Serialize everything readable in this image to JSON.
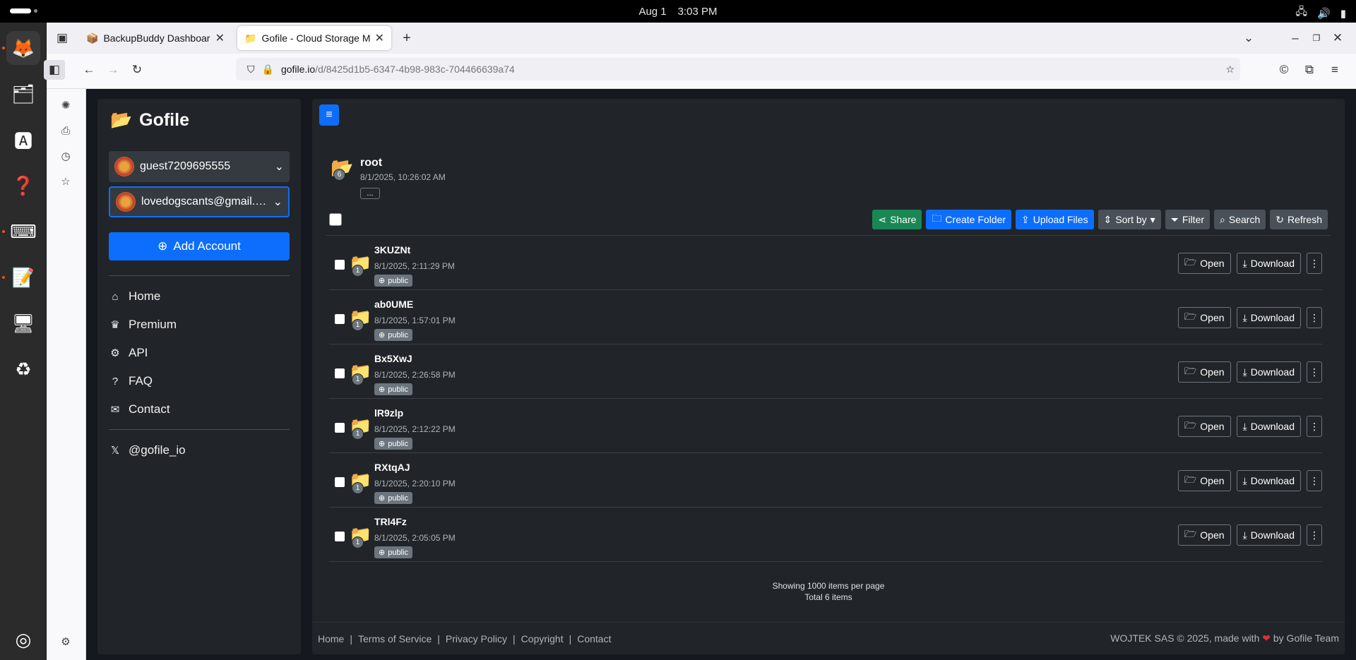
{
  "system": {
    "date": "Aug 1",
    "time": "3:03 PM"
  },
  "browser": {
    "tabs": [
      {
        "icon": "📦",
        "label": "BackupBuddy Dashboard"
      },
      {
        "icon": "📁",
        "label": "Gofile - Cloud Storage Ma"
      }
    ],
    "url_host": "gofile.io",
    "url_path": "/d/8425d1b5-6347-4b98-983c-704466639a74"
  },
  "sidebar": {
    "brand": "Gofile",
    "accounts": [
      "guest7209695555",
      "lovedogscants@gmail.c..."
    ],
    "add_account": "Add Account",
    "menu": [
      "Home",
      "Premium",
      "API",
      "FAQ",
      "Contact"
    ],
    "social": "@gofile_io"
  },
  "folder": {
    "name": "root",
    "date": "8/1/2025, 10:26:02 AM",
    "count": "6",
    "more": "..."
  },
  "toolbar": {
    "share": "Share",
    "create_folder": "Create Folder",
    "upload": "Upload Files",
    "sort": "Sort by",
    "filter": "Filter",
    "search": "Search",
    "refresh": "Refresh"
  },
  "rows": [
    {
      "name": "3KUZNt",
      "date": "8/1/2025, 2:11:29 PM",
      "count": "1",
      "badge": "public"
    },
    {
      "name": "ab0UME",
      "date": "8/1/2025, 1:57:01 PM",
      "count": "1",
      "badge": "public"
    },
    {
      "name": "Bx5XwJ",
      "date": "8/1/2025, 2:26:58 PM",
      "count": "1",
      "badge": "public"
    },
    {
      "name": "lR9zlp",
      "date": "8/1/2025, 2:12:22 PM",
      "count": "1",
      "badge": "public"
    },
    {
      "name": "RXtqAJ",
      "date": "8/1/2025, 2:20:10 PM",
      "count": "1",
      "badge": "public"
    },
    {
      "name": "TRl4Fz",
      "date": "8/1/2025, 2:05:05 PM",
      "count": "1",
      "badge": "public"
    }
  ],
  "row_actions": {
    "open": "Open",
    "download": "Download"
  },
  "pagination": {
    "per_page": "Showing 1000 items per page",
    "total": "Total 6 items"
  },
  "footer": {
    "links": [
      "Home",
      "Terms of Service",
      "Privacy Policy",
      "Copyright",
      "Contact"
    ],
    "separator": "|",
    "copyright_prefix": "WOJTEK SAS © 2025, made with",
    "copyright_suffix": "by Gofile Team"
  }
}
